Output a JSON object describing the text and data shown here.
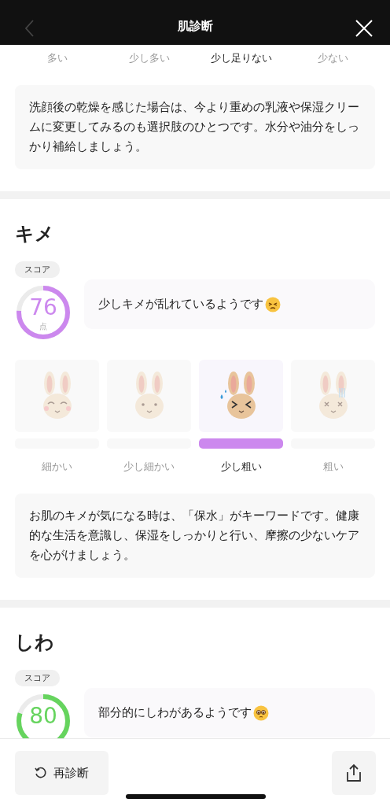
{
  "header": {
    "title": "肌診断",
    "back_disabled": true
  },
  "sections": [
    {
      "levels": [
        {
          "label": "多い",
          "selected": false
        },
        {
          "label": "少し多い",
          "selected": false
        },
        {
          "label": "少し足りない",
          "selected": true
        },
        {
          "label": "少ない",
          "selected": false
        }
      ],
      "tip": "洗顔後の乾燥を感じた場合は、今より重めの乳液や保湿クリームに変更してみるのも選択肢のひとつです。水分や油分をしっかり補給しましょう。"
    },
    {
      "title": "キメ",
      "score_label": "スコア",
      "score": "76",
      "unit": "点",
      "color": "#cc88ee",
      "message": "少しキメが乱れているようです",
      "emoji": {
        "kind": "persevering"
      },
      "levels": [
        {
          "label": "細かい",
          "selected": false,
          "kind": "happy"
        },
        {
          "label": "少し細かい",
          "selected": false,
          "kind": "calm"
        },
        {
          "label": "少し粗い",
          "selected": true,
          "kind": "squint"
        },
        {
          "label": "粗い",
          "selected": false,
          "kind": "dizzy"
        }
      ],
      "tip": "お肌のキメが気になる時は、「保水」がキーワードです。健康的な生活を意識し、保湿をしっかりと行い、摩擦の少ないケアを心がけましょう。"
    },
    {
      "title": "しわ",
      "score_label": "スコア",
      "score": "80",
      "color": "#66d45e",
      "message": "部分的にしわがあるようです",
      "emoji": {
        "kind": "pleading"
      }
    }
  ],
  "footer": {
    "rediagnose": "再診断"
  }
}
